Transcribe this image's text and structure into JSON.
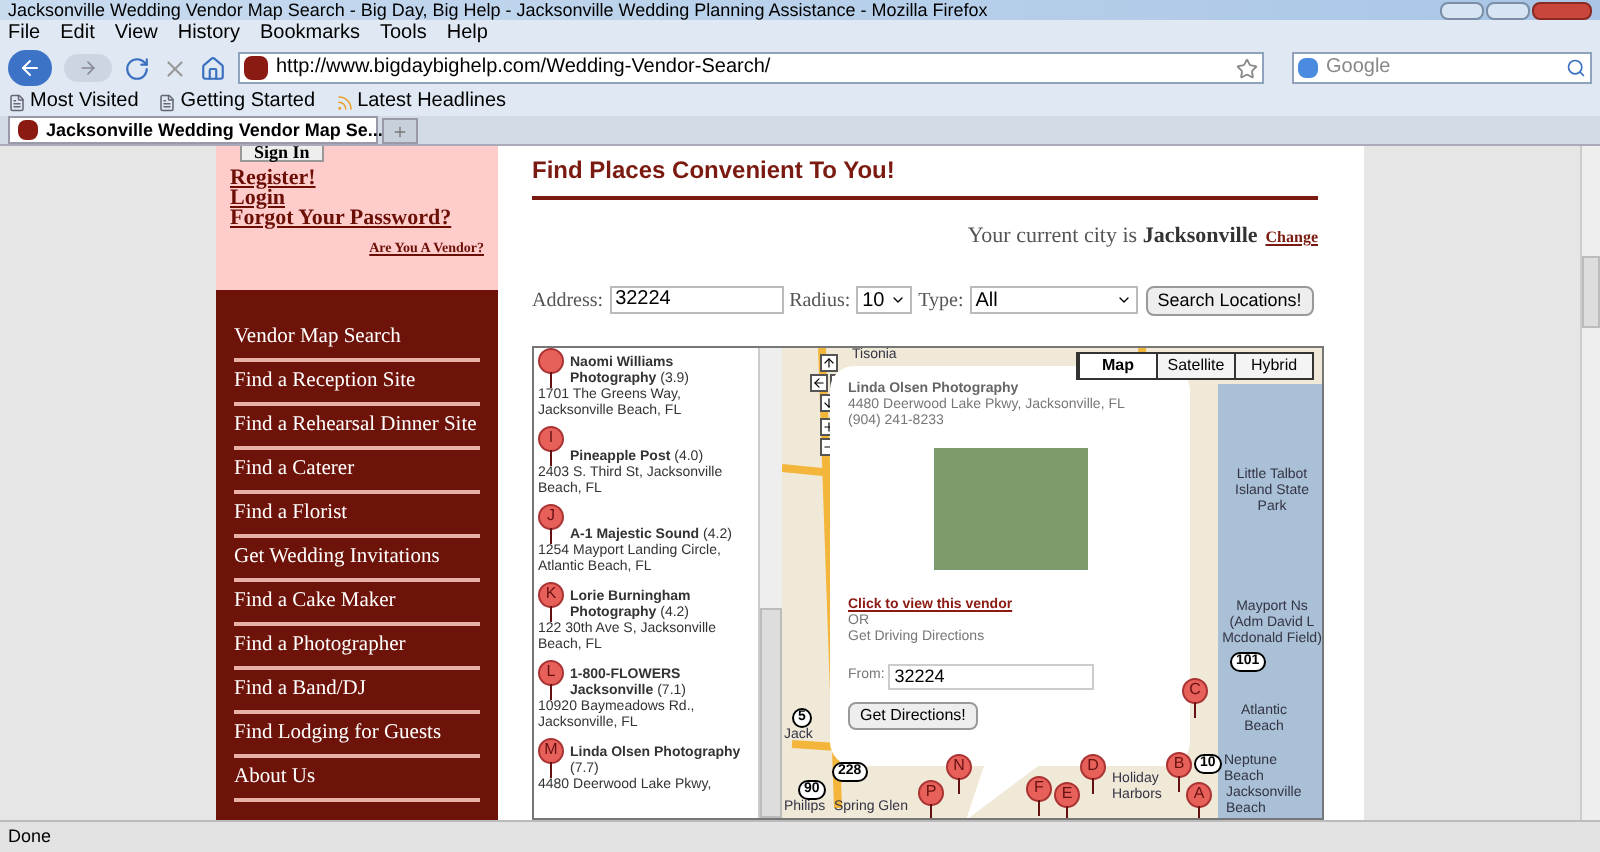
{
  "window": {
    "title": "Jacksonville Wedding Vendor Map Search - Big Day, Big Help - Jacksonville Wedding Planning Assistance - Mozilla Firefox"
  },
  "menu": [
    "File",
    "Edit",
    "View",
    "History",
    "Bookmarks",
    "Tools",
    "Help"
  ],
  "address_bar": {
    "url": "http://www.bigdaybighelp.com/Wedding-Vendor-Search/"
  },
  "search_bar": {
    "placeholder": "Google"
  },
  "bookmarks": [
    "Most Visited",
    "Getting Started",
    "Latest Headlines"
  ],
  "tabs": [
    {
      "label": "Jacksonville Wedding Vendor Map Se...",
      "selected": true
    }
  ],
  "account": {
    "sign_in": "Sign In",
    "links": [
      "Register!",
      "Login",
      "Forgot Your Password?"
    ],
    "vendor_link": "Are You A Vendor?"
  },
  "sidebar": {
    "items": [
      "Vendor Map Search",
      "Find a Reception Site",
      "Find a Rehearsal Dinner Site",
      "Find a Caterer",
      "Find a Florist",
      "Get Wedding Invitations",
      "Find a Cake Maker",
      "Find a Photographer",
      "Find a Band/DJ",
      "Find Lodging for Guests",
      "About Us"
    ]
  },
  "heading": "Find Places Convenient To You!",
  "city": {
    "prefix": "Your current city is",
    "name": "Jacksonville",
    "change": "Change"
  },
  "search_form": {
    "address_label": "Address:",
    "address": "32224",
    "radius_label": "Radius:",
    "radius": "10",
    "type_label": "Type:",
    "type": "All",
    "button": "Search Locations!"
  },
  "results": [
    {
      "name": "Naomi Williams Photography",
      "rating": "(3.9)",
      "address": "1701 The Greens Way, Jacksonville Beach, FL"
    },
    {
      "marker": "I",
      "name": "Pineapple Post",
      "rating": "(4.0)",
      "address": "2403 S. Third St, Jacksonville Beach, FL"
    },
    {
      "marker": "J",
      "name": "A-1 Majestic Sound",
      "rating": "(4.2)",
      "address": "1254 Mayport Landing Circle, Atlantic Beach, FL"
    },
    {
      "marker": "K",
      "name": "Lorie Burningham Photography",
      "rating": "(4.2)",
      "address": "122 30th Ave S, Jacksonville Beach, FL"
    },
    {
      "marker": "L",
      "name": "1-800-FLOWERS Jacksonville",
      "rating": "(7.1)",
      "address": "10920 Baymeadows Rd., Jacksonville, FL"
    },
    {
      "marker": "M",
      "name": "Linda Olsen Photography",
      "rating": "(7.7)",
      "address": "4480 Deerwood Lake Pkwy,"
    }
  ],
  "map": {
    "types": [
      {
        "label": "Map",
        "selected": true
      },
      {
        "label": "Satellite",
        "selected": false
      },
      {
        "label": "Hybrid",
        "selected": false
      }
    ],
    "labels": [
      "Tisonia",
      "Little Talbot Island State Park",
      "Mayport Ns (Adm David L Mcdonald Field)",
      "Atlantic Beach",
      "Neptune Beach",
      "Jacksonville Beach",
      "Jack",
      "Philips",
      "Spring Glen",
      "Holiday Harbors"
    ],
    "markers": [
      "C",
      "D",
      "F",
      "E",
      "N",
      "P",
      "B",
      "A"
    ],
    "shields": [
      "101",
      "10",
      "5",
      "228",
      "90"
    ]
  },
  "popup": {
    "name": "Linda Olsen Photography",
    "address": "4480 Deerwood Lake Pkwy, Jacksonville, FL",
    "phone": "(904) 241-8233",
    "link": "Click to view this vendor",
    "or": "OR",
    "directions_label": "Get Driving Directions",
    "from_label": "From:",
    "from": "32224",
    "button": "Get Directions!"
  },
  "status_bar": {
    "text": "Done"
  }
}
